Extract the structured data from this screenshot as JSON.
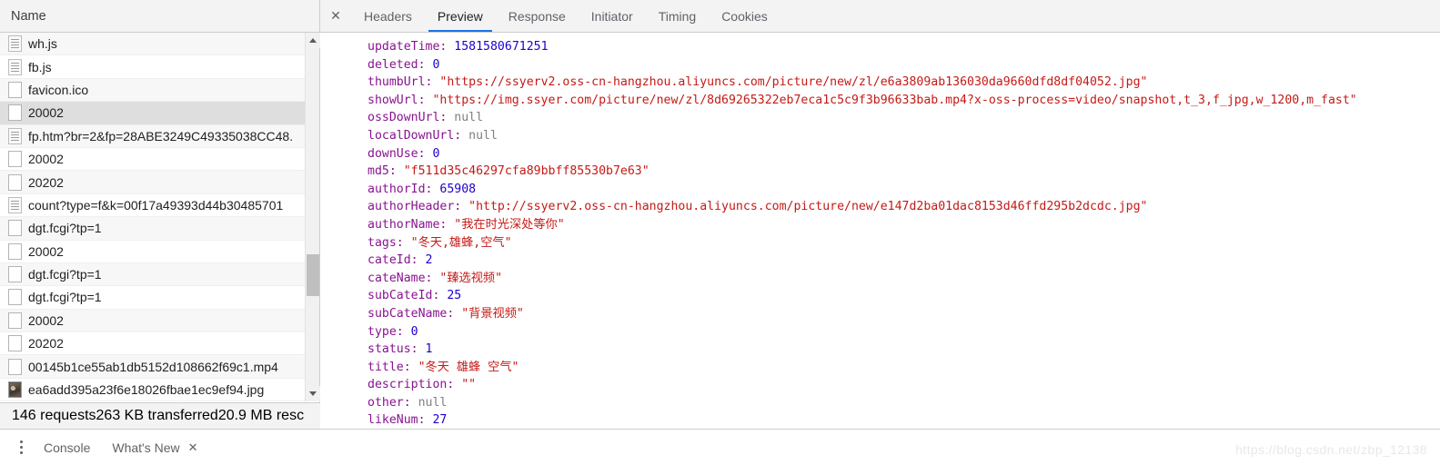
{
  "request_list": {
    "header": {
      "column_name": "Name"
    },
    "rows": [
      {
        "name": "wh.js",
        "icon": "script-file-icon",
        "selected": false
      },
      {
        "name": "fb.js",
        "icon": "script-file-icon",
        "selected": false
      },
      {
        "name": "favicon.ico",
        "icon": "generic-file-icon",
        "selected": false
      },
      {
        "name": "20002",
        "icon": "generic-file-icon",
        "selected": true
      },
      {
        "name": "fp.htm?br=2&fp=28ABE3249C49335038CC48.",
        "icon": "script-file-icon",
        "selected": false
      },
      {
        "name": "20002",
        "icon": "generic-file-icon",
        "selected": false
      },
      {
        "name": "20202",
        "icon": "generic-file-icon",
        "selected": false
      },
      {
        "name": "count?type=f&k=00f17a49393d44b30485701",
        "icon": "script-file-icon",
        "selected": false
      },
      {
        "name": "dgt.fcgi?tp=1",
        "icon": "generic-file-icon",
        "selected": false
      },
      {
        "name": "20002",
        "icon": "generic-file-icon",
        "selected": false
      },
      {
        "name": "dgt.fcgi?tp=1",
        "icon": "generic-file-icon",
        "selected": false
      },
      {
        "name": "dgt.fcgi?tp=1",
        "icon": "generic-file-icon",
        "selected": false
      },
      {
        "name": "20002",
        "icon": "generic-file-icon",
        "selected": false
      },
      {
        "name": "20202",
        "icon": "generic-file-icon",
        "selected": false
      },
      {
        "name": "00145b1ce55ab1db5152d108662f69c1.mp4",
        "icon": "generic-file-icon",
        "selected": false
      },
      {
        "name": "ea6add395a23f6e18026fbae1ec9ef94.jpg",
        "icon": "image-thumbnail-icon",
        "selected": false
      }
    ],
    "scrollbar": {
      "up_arrow": "▲",
      "down_arrow": "▼"
    }
  },
  "status_bar": {
    "requests": "146 requests",
    "transferred": "263 KB transferred",
    "resources": "20.9 MB resc"
  },
  "detail_panel": {
    "close_icon_label": "✕",
    "tabs": [
      {
        "label": "Headers",
        "active": false
      },
      {
        "label": "Preview",
        "active": true
      },
      {
        "label": "Response",
        "active": false
      },
      {
        "label": "Initiator",
        "active": false
      },
      {
        "label": "Timing",
        "active": false
      },
      {
        "label": "Cookies",
        "active": false
      }
    ],
    "active_tab": "Preview",
    "accent_color": "#1a73e8"
  },
  "preview_json": {
    "lines": [
      {
        "key": "updateTime",
        "type": "number",
        "value": "1581580671251"
      },
      {
        "key": "deleted",
        "type": "number",
        "value": "0"
      },
      {
        "key": "thumbUrl",
        "type": "string",
        "value": "https://ssyerv2.oss-cn-hangzhou.aliyuncs.com/picture/new/zl/e6a3809ab136030da9660dfd8df04052.jpg"
      },
      {
        "key": "showUrl",
        "type": "string",
        "value": "https://img.ssyer.com/picture/new/zl/8d69265322eb7eca1c5c9f3b96633bab.mp4?x-oss-process=video/snapshot,t_3,f_jpg,w_1200,m_fast"
      },
      {
        "key": "ossDownUrl",
        "type": "null",
        "value": "null"
      },
      {
        "key": "localDownUrl",
        "type": "null",
        "value": "null"
      },
      {
        "key": "downUse",
        "type": "number",
        "value": "0"
      },
      {
        "key": "md5",
        "type": "string",
        "value": "f511d35c46297cfa89bbff85530b7e63"
      },
      {
        "key": "authorId",
        "type": "number",
        "value": "65908"
      },
      {
        "key": "authorHeader",
        "type": "string",
        "value": "http://ssyerv2.oss-cn-hangzhou.aliyuncs.com/picture/new/e147d2ba01dac8153d46ffd295b2dcdc.jpg"
      },
      {
        "key": "authorName",
        "type": "string",
        "value": "我在时光深处等你"
      },
      {
        "key": "tags",
        "type": "string",
        "value": "冬天,雄蜂,空气"
      },
      {
        "key": "cateId",
        "type": "number",
        "value": "2"
      },
      {
        "key": "cateName",
        "type": "string",
        "value": "臻选视频"
      },
      {
        "key": "subCateId",
        "type": "number",
        "value": "25"
      },
      {
        "key": "subCateName",
        "type": "string",
        "value": "背景视频"
      },
      {
        "key": "type",
        "type": "number",
        "value": "0"
      },
      {
        "key": "status",
        "type": "number",
        "value": "1"
      },
      {
        "key": "title",
        "type": "string",
        "value": "冬天 雄蜂 空气"
      },
      {
        "key": "description",
        "type": "string",
        "value": ""
      },
      {
        "key": "other",
        "type": "null",
        "value": "null"
      },
      {
        "key": "likeNum",
        "type": "number",
        "value": "27"
      }
    ],
    "colors": {
      "key": "#881391",
      "number": "#1c00cf",
      "string": "#c41a16",
      "null": "#808080"
    }
  },
  "drawer": {
    "menu_icon_label": "more-options",
    "tabs": [
      {
        "label": "Console",
        "closable": false,
        "close_label": ""
      },
      {
        "label": "What's New",
        "closable": true,
        "close_label": "✕"
      }
    ]
  },
  "watermark": {
    "text": "https://blog.csdn.net/zbp_12138"
  }
}
